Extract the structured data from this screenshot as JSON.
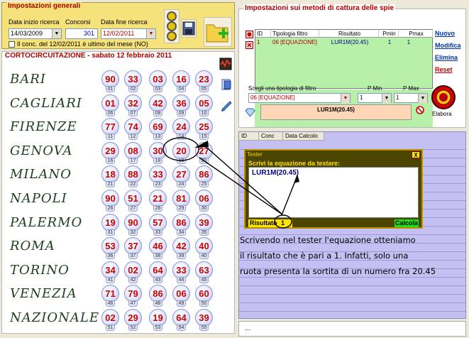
{
  "general": {
    "title": "Impostazioni generali",
    "start_label": "Data inizio ricerca",
    "start_value": "14/03/2009",
    "count_label": "Concorsi",
    "count_value": "301",
    "end_label": "Data fine ricerca",
    "end_value": "12/02/2011",
    "last_of_month_label": "Il conc. del 12/02/2011 è ultimo del mese (NO)"
  },
  "draw": {
    "title": "CORTOCIRCUITAZIONE - sabato 12 febbraio 2011",
    "wheels": [
      {
        "name": "BARI",
        "numbers": [
          "90",
          "33",
          "03",
          "16",
          "23"
        ],
        "positions": [
          "01",
          "02",
          "03",
          "04",
          "05"
        ]
      },
      {
        "name": "CAGLIARI",
        "numbers": [
          "01",
          "32",
          "42",
          "36",
          "05"
        ],
        "positions": [
          "06",
          "07",
          "08",
          "09",
          "10"
        ]
      },
      {
        "name": "FIRENZE",
        "numbers": [
          "77",
          "74",
          "69",
          "24",
          "25"
        ],
        "positions": [
          "11",
          "12",
          "13",
          "14",
          "15"
        ]
      },
      {
        "name": "GENOVA",
        "numbers": [
          "29",
          "08",
          "30",
          "20",
          "27"
        ],
        "positions": [
          "16",
          "17",
          "18",
          "19",
          "20"
        ]
      },
      {
        "name": "MILANO",
        "numbers": [
          "18",
          "88",
          "33",
          "27",
          "86"
        ],
        "positions": [
          "21",
          "22",
          "23",
          "24",
          "25"
        ]
      },
      {
        "name": "NAPOLI",
        "numbers": [
          "90",
          "51",
          "21",
          "81",
          "06"
        ],
        "positions": [
          "26",
          "27",
          "28",
          "29",
          "30"
        ]
      },
      {
        "name": "PALERMO",
        "numbers": [
          "19",
          "90",
          "57",
          "86",
          "39"
        ],
        "positions": [
          "31",
          "32",
          "33",
          "34",
          "35"
        ]
      },
      {
        "name": "ROMA",
        "numbers": [
          "53",
          "37",
          "46",
          "42",
          "40"
        ],
        "positions": [
          "36",
          "37",
          "38",
          "39",
          "40"
        ]
      },
      {
        "name": "TORINO",
        "numbers": [
          "34",
          "02",
          "64",
          "33",
          "63"
        ],
        "positions": [
          "41",
          "42",
          "43",
          "44",
          "45"
        ]
      },
      {
        "name": "VENEZIA",
        "numbers": [
          "71",
          "79",
          "86",
          "06",
          "60"
        ],
        "positions": [
          "46",
          "47",
          "48",
          "49",
          "50"
        ]
      },
      {
        "name": "NAZIONALE",
        "numbers": [
          "02",
          "29",
          "19",
          "64",
          "39"
        ],
        "positions": [
          "51",
          "52",
          "53",
          "54",
          "55"
        ]
      }
    ]
  },
  "methods": {
    "title": "Impostazioni sui metodi di cattura delle spie",
    "headers": {
      "id": "ID",
      "type": "Tipologia filtro",
      "result": "Risultato",
      "pmin": "Pmin",
      "pmax": "Pmax"
    },
    "row": {
      "id": "1",
      "type": "06 [EQUAZIONE]",
      "result": "LUR1M(20.45)",
      "pmin": "1",
      "pmax": "1"
    },
    "links": {
      "new": "Nuovo",
      "edit": "Modifica",
      "delete": "Elimina",
      "reset": "Reset"
    },
    "filter_label": "Scegli una tipologia di filtro",
    "filter_value": "06 [EQUAZIONE]",
    "pmin_label": "P Min",
    "pmin_value": "1",
    "pmax_label": "P Max",
    "pmax_value": "1",
    "result_value": "LUR1M(20.45)",
    "process_label": "Elabora"
  },
  "list": {
    "headers": {
      "id": "ID",
      "conc": "Conc",
      "date": "Data Calcolo"
    }
  },
  "tester": {
    "title": "Tester",
    "close": "X",
    "prompt": "Scrivi la equazione da testare:",
    "equation": "LUR1M(20.45)",
    "result_label": "Risultato",
    "result_value": "1",
    "calculate": "Calcola"
  },
  "note": {
    "line1": "Scrivendo nel tester l'equazione otteniamo",
    "line2": "il risultato che è pari a 1. Infatti, solo una",
    "line3": "ruota presenta la sortita di un numero fra 20.45"
  },
  "bottom": {
    "text": "..."
  }
}
